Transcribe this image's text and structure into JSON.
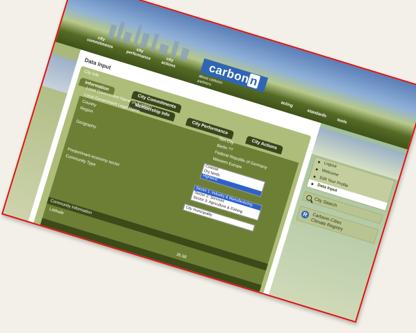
{
  "header": {
    "nav": [
      "city commitments",
      "city performance",
      "city actions"
    ],
    "logo_text": "carbon",
    "logo_n": "n",
    "logo_sub1": "about carbonn",
    "logo_sub2": "partners",
    "right_nav": [
      "acting",
      "standards",
      "tools"
    ]
  },
  "page": {
    "title": "Data Input",
    "panel_label": "City Info"
  },
  "tabs": {
    "information": "Information",
    "commitments": "City Commitments",
    "membership": "Membership Info",
    "performance": "City Performance",
    "actions": "City Actions"
  },
  "form": {
    "labels": {
      "name_english": "Local Government Name (in English)",
      "legal_name": "Local Government Legal Name",
      "country": "Country",
      "region": "Region",
      "geography": "Geography",
      "economy": "Predominant economy sector",
      "community_type": "Community Type"
    },
    "values": {
      "name_english": "Sim City",
      "legal_name": "Berlin ??",
      "country": "Federal Republic of Germany",
      "region": "Western Europe"
    },
    "geography_options": [
      "Coastal",
      "Dry lands",
      "Highland"
    ],
    "geography_selected": 2,
    "economy_options": [
      "Sector 1: Industry & Manufacturing",
      "Sector 2: Services",
      "Sector 3: Agriculture & Fishing"
    ],
    "economy_selected": 0,
    "community_type_value": "City municipality",
    "community_section": "Community Information",
    "latitude_label": "Latitude",
    "latitude_value": "35.68"
  },
  "sidebar": {
    "items": [
      "Logout",
      "Welcome",
      "Edit Your Profile",
      "Data Input"
    ],
    "active_index": 3,
    "search_label": "City Search",
    "registry_line1": "Carbonn Cities",
    "registry_line2": "Climate Registry"
  },
  "colors": {
    "frame_border": "#e01010",
    "panel_dark": "#38461a",
    "panel_mid": "#6c7f35",
    "logo_blue": "#2f66b3"
  }
}
